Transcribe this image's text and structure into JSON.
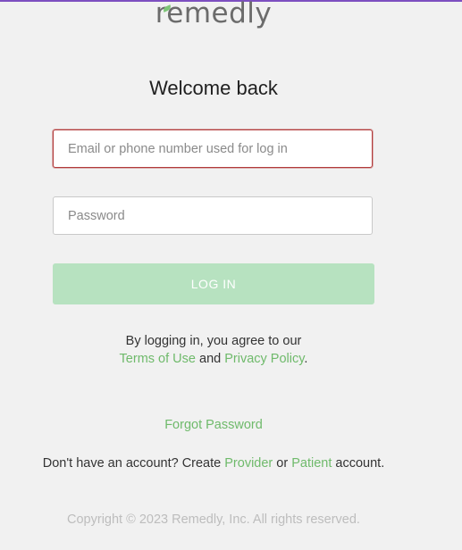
{
  "brand": {
    "logo_text": "remedly",
    "accent_color": "#7d4fc0",
    "leaf_color": "#7cc576"
  },
  "login": {
    "title": "Welcome back",
    "email_placeholder": "Email or phone number used for log in",
    "email_value": "",
    "password_placeholder": "Password",
    "password_value": "",
    "login_button_label": "LOG IN",
    "button_color": "#b7e2c0"
  },
  "agreement": {
    "prefix": "By logging in, you agree to our",
    "terms_link": "Terms of Use",
    "and_text": "and",
    "privacy_link": "Privacy Policy",
    "suffix": "."
  },
  "forgot_password_link": "Forgot Password",
  "create_account": {
    "prefix": "Don't have an account? Create",
    "provider_link": "Provider",
    "or_text": "or",
    "patient_link": "Patient",
    "suffix": "account."
  },
  "footer": {
    "copyright": "Copyright © 2023 Remedly, Inc. All rights reserved."
  },
  "link_color": "#6fba6b",
  "error_border_color": "#b23a3a"
}
